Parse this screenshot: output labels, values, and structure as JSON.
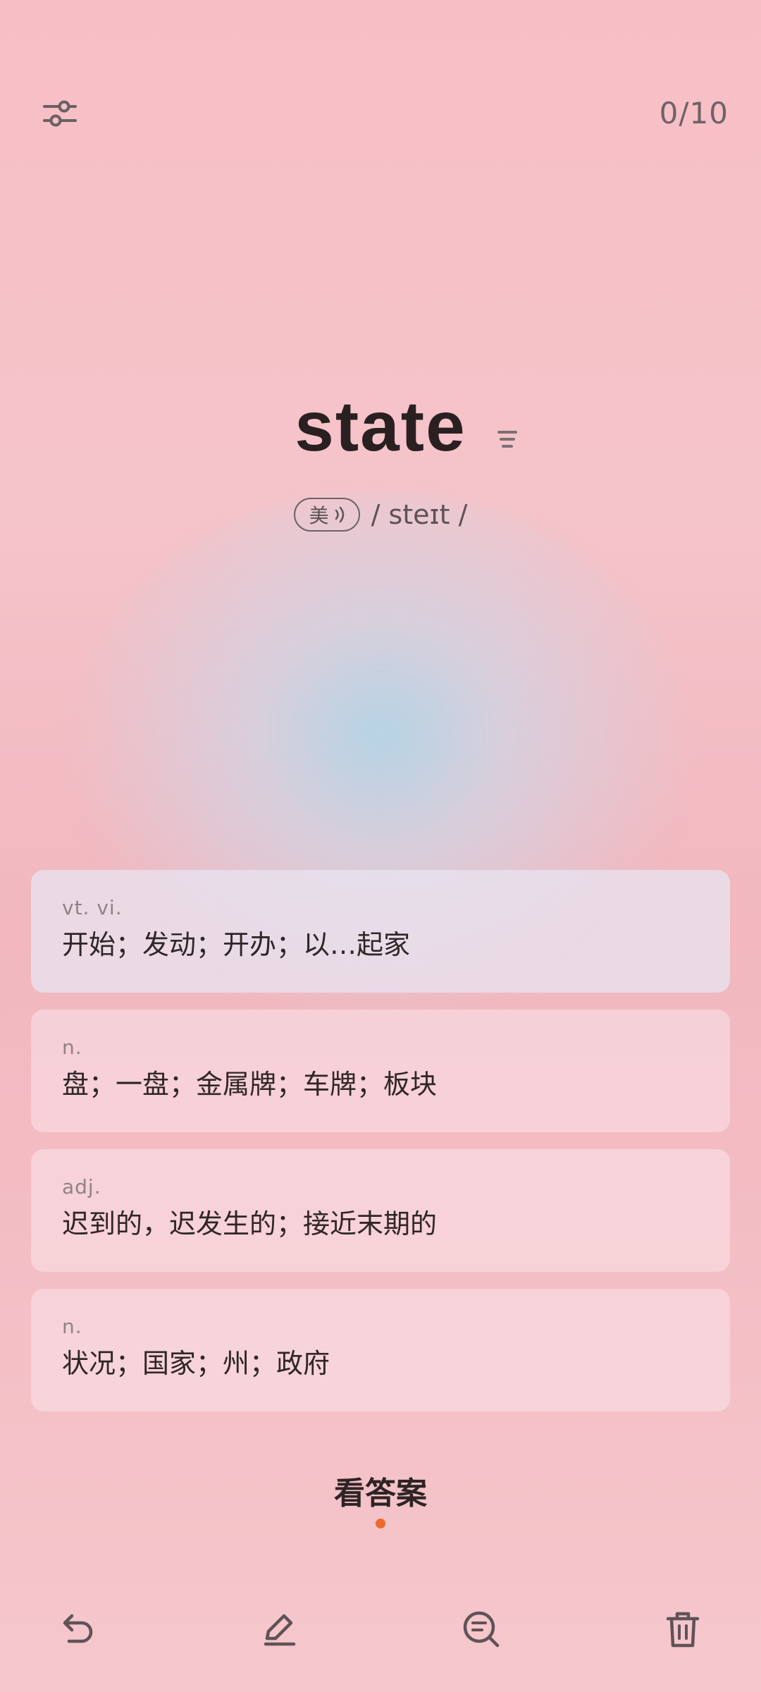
{
  "header": {
    "settings_icon": "sliders-icon",
    "counter": "0/10"
  },
  "word": {
    "text": "state",
    "menu_icon": "lines-icon",
    "accent_label": "美",
    "sound_icon": "sound-icon",
    "phonetic": "/ steɪt /"
  },
  "definitions": [
    {
      "pos": "vt.  vi.",
      "meaning": "开始；发动；开办；以…起家"
    },
    {
      "pos": "n.",
      "meaning": "盘；一盘；金属牌；车牌；板块"
    },
    {
      "pos": "adj.",
      "meaning": "迟到的，迟发生的；接近末期的"
    },
    {
      "pos": "n.",
      "meaning": "状况；国家；州；政府"
    }
  ],
  "answer_button": "看答案",
  "toolbar": {
    "icons": [
      "undo-icon",
      "edit-icon",
      "search-list-icon",
      "trash-icon"
    ]
  },
  "colors": {
    "indicator": "#ef6a2a",
    "background": "#f5c4ca"
  }
}
